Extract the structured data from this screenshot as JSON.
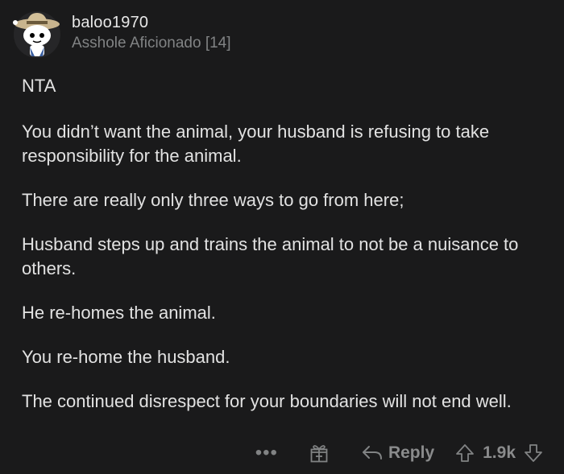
{
  "comment": {
    "username": "baloo1970",
    "flair": "Asshole Aficionado [14]",
    "paragraphs": [
      "NTA",
      "You didn’t want the animal, your husband is refusing to take responsibility for the animal.",
      "There are really only three ways to go from here;",
      "Husband steps up and trains the animal to not be a nuisance to others.",
      "He re-homes the animal.",
      "You re-home the husband.",
      "The continued disrespect for your boundaries will not end well."
    ]
  },
  "actions": {
    "more_label": "•••",
    "reply_label": "Reply",
    "score": "1.9k"
  },
  "icons": {
    "avatar": "snoo-explorer-avatar",
    "award": "gift-icon",
    "reply": "reply-arrow-icon",
    "upvote": "upvote-arrow-icon",
    "downvote": "downvote-arrow-icon"
  },
  "colors": {
    "background": "#1a1a1b",
    "text": "#e2e2e2",
    "muted": "#818384"
  }
}
